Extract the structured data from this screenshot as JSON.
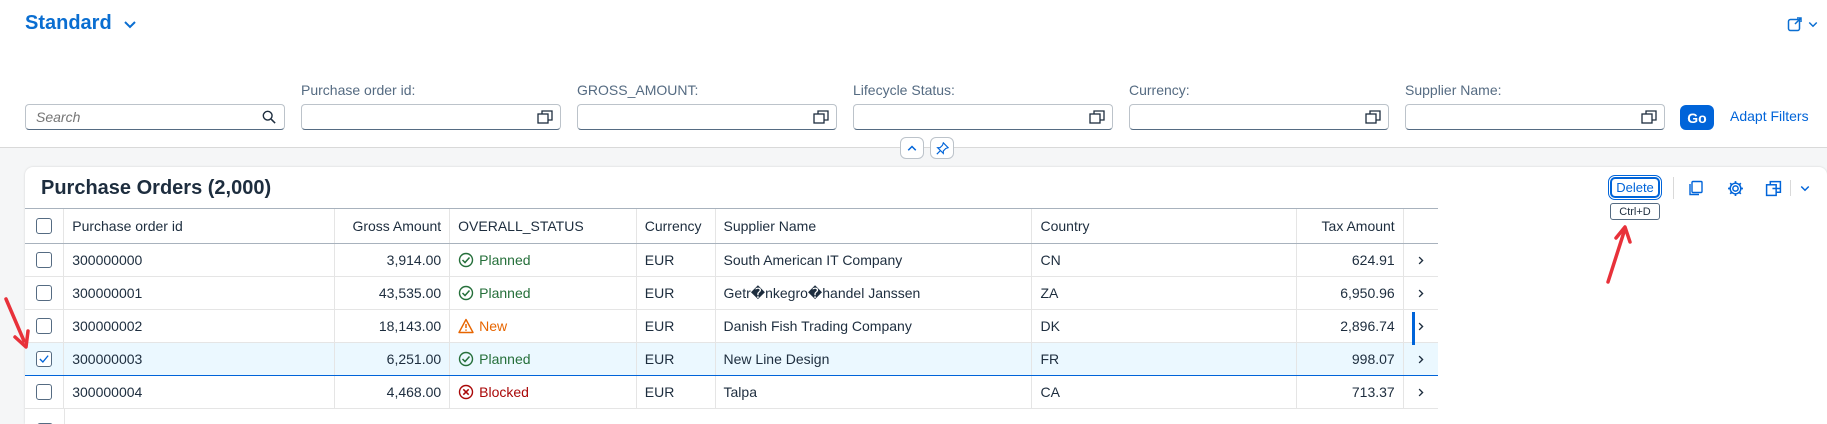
{
  "header": {
    "variant_title": "Standard",
    "search_placeholder": "Search",
    "filters": [
      {
        "label": "Purchase order id:",
        "value": ""
      },
      {
        "label": "GROSS_AMOUNT:",
        "value": ""
      },
      {
        "label": "Lifecycle Status:",
        "value": ""
      },
      {
        "label": "Currency:",
        "value": ""
      },
      {
        "label": "Supplier Name:",
        "value": ""
      }
    ],
    "go_label": "Go",
    "adapt_label": "Adapt Filters"
  },
  "table": {
    "title": "Purchase Orders (2,000)",
    "delete_label": "Delete",
    "delete_tooltip": "Ctrl+D",
    "columns": [
      "Purchase order id",
      "Gross Amount",
      "OVERALL_STATUS",
      "Currency",
      "Supplier Name",
      "Country",
      "Tax Amount"
    ],
    "rows": [
      {
        "id": "300000000",
        "gross": "3,914.00",
        "status": "Planned",
        "status_type": "success",
        "currency": "EUR",
        "supplier": "South American IT Company",
        "country": "CN",
        "tax": "624.91",
        "checked": false
      },
      {
        "id": "300000001",
        "gross": "43,535.00",
        "status": "Planned",
        "status_type": "success",
        "currency": "EUR",
        "supplier": "Getr�nkegro�handel Janssen",
        "country": "ZA",
        "tax": "6,950.96",
        "checked": false
      },
      {
        "id": "300000002",
        "gross": "18,143.00",
        "status": "New",
        "status_type": "warning",
        "currency": "EUR",
        "supplier": "Danish Fish Trading Company",
        "country": "DK",
        "tax": "2,896.74",
        "checked": false
      },
      {
        "id": "300000003",
        "gross": "6,251.00",
        "status": "Planned",
        "status_type": "success",
        "currency": "EUR",
        "supplier": "New Line Design",
        "country": "FR",
        "tax": "998.07",
        "checked": true
      },
      {
        "id": "300000004",
        "gross": "4,468.00",
        "status": "Blocked",
        "status_type": "error",
        "currency": "EUR",
        "supplier": "Talpa",
        "country": "CA",
        "tax": "713.37",
        "checked": false
      }
    ]
  },
  "colors": {
    "accent": "#0064d9",
    "success": "#256f3a",
    "warning": "#e76500",
    "error": "#aa0808",
    "annotation_arrow": "#e8313a"
  }
}
